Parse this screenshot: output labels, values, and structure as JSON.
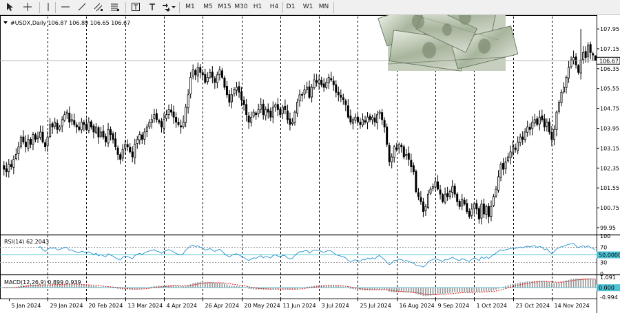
{
  "toolbar": {
    "timeframes": [
      "M1",
      "M5",
      "M15",
      "M30",
      "H1",
      "H4",
      "D1",
      "W1",
      "MN"
    ]
  },
  "colors": {
    "candle": "#000000",
    "rsi_line": "#1f8fd0",
    "rsi_level": "#4fc3d6",
    "macd_signal": "#d01818",
    "macd_hist": "#9a9a9a",
    "macd_zero": "#4fc3d6",
    "grid": "#000000",
    "price_line": "#b0b0b0"
  },
  "chart_data": [
    {
      "type": "candlestick",
      "title": "#USDX,Daily 106.87 106.89 106.65 106.67",
      "symbol": "#USDX",
      "timeframe": "Daily",
      "ohlc_last": {
        "open": 106.87,
        "high": 106.89,
        "low": 106.65,
        "close": 106.67
      },
      "current_price_label": "106.67",
      "ylim": [
        99.7,
        108.45
      ],
      "y_ticks": [
        "107.95",
        "107.15",
        "106.35",
        "105.55",
        "104.75",
        "103.95",
        "103.15",
        "102.35",
        "101.55",
        "100.75",
        "99.95"
      ],
      "x_ticks": [
        "5 Jan 2024",
        "29 Jan 2024",
        "20 Feb 2024",
        "13 Mar 2024",
        "4 Apr 2024",
        "26 Apr 2024",
        "20 May 2024",
        "11 Jun 2024",
        "3 Jul 2024",
        "25 Jul 2024",
        "16 Aug 2024",
        "9 Sep 2024",
        "1 Oct 2024",
        "23 Oct 2024",
        "14 Nov 2024"
      ],
      "closes": [
        102.3,
        102.2,
        102.5,
        102.4,
        102.7,
        102.9,
        103.2,
        103.6,
        103.4,
        103.2,
        103.5,
        103.3,
        103.7,
        103.5,
        103.6,
        103.8,
        103.4,
        103.2,
        103.6,
        104.1,
        104.0,
        104.2,
        103.9,
        104.0,
        104.3,
        104.5,
        104.6,
        104.2,
        104.3,
        104.1,
        104.0,
        103.9,
        104.2,
        104.1,
        103.9,
        104.2,
        104.0,
        103.8,
        104.0,
        103.6,
        103.8,
        103.6,
        103.4,
        103.9,
        103.7,
        103.5,
        103.2,
        102.9,
        102.7,
        103.1,
        103.3,
        103.2,
        103.0,
        102.8,
        103.3,
        103.5,
        103.7,
        103.5,
        103.8,
        104.0,
        104.2,
        104.3,
        104.5,
        104.3,
        104.2,
        104.0,
        104.3,
        104.5,
        104.7,
        104.6,
        104.4,
        104.2,
        104.1,
        104.0,
        104.2,
        104.8,
        105.3,
        106.0,
        106.3,
        106.1,
        106.4,
        106.2,
        106.1,
        105.8,
        106.0,
        106.2,
        106.0,
        105.8,
        106.1,
        106.3,
        106.0,
        105.6,
        105.3,
        105.0,
        105.3,
        105.5,
        105.6,
        105.4,
        105.1,
        104.9,
        104.5,
        104.2,
        104.4,
        104.6,
        104.5,
        104.7,
        104.9,
        104.5,
        104.7,
        104.6,
        104.4,
        104.8,
        104.9,
        104.7,
        104.5,
        104.8,
        104.7,
        104.3,
        104.1,
        104.2,
        104.6,
        105.0,
        105.3,
        105.3,
        105.5,
        105.6,
        105.2,
        105.6,
        105.9,
        105.8,
        105.9,
        105.7,
        105.6,
        105.8,
        106.0,
        105.9,
        105.7,
        105.4,
        105.3,
        105.2,
        105.1,
        104.9,
        104.4,
        104.2,
        104.3,
        104.4,
        104.2,
        104.1,
        104.3,
        104.2,
        104.4,
        104.3,
        104.4,
        104.2,
        104.5,
        104.6,
        104.3,
        104.0,
        103.3,
        102.6,
        102.8,
        103.2,
        103.1,
        103.3,
        103.2,
        102.8,
        102.9,
        102.7,
        102.4,
        102.2,
        101.4,
        101.2,
        101.0,
        100.6,
        100.8,
        101.3,
        101.5,
        101.6,
        101.8,
        101.5,
        101.3,
        101.0,
        101.3,
        101.2,
        101.4,
        101.6,
        101.3,
        101.0,
        100.8,
        101.1,
        100.9,
        100.6,
        100.4,
        100.7,
        100.9,
        100.7,
        100.3,
        100.9,
        100.5,
        100.8,
        100.4,
        100.8,
        101.2,
        101.5,
        102.0,
        102.5,
        102.3,
        102.6,
        102.8,
        103.0,
        103.2,
        103.1,
        103.4,
        103.6,
        103.5,
        103.8,
        104.0,
        103.9,
        104.2,
        104.3,
        104.1,
        104.4,
        104.3,
        104.0,
        104.2,
        103.8,
        103.5,
        103.9,
        104.6,
        105.0,
        105.4,
        105.6,
        106.0,
        106.4,
        106.7,
        106.8,
        106.5,
        106.2,
        106.7,
        107.0,
        106.8,
        107.3,
        107.0,
        106.9,
        106.67
      ],
      "rsi": {
        "label": "RSI(14) 62.2043",
        "period": 14,
        "value": 62.2043,
        "level_label": "50.0000",
        "ylim": [
          0,
          100
        ],
        "y_ticks": [
          "100",
          "70",
          "30",
          "0"
        ]
      },
      "macd": {
        "label": "MACD(12,26,9) 0.899 0.939",
        "params": [
          12,
          26,
          9
        ],
        "macd": 0.899,
        "signal": 0.939,
        "y_ticks": [
          "1.091",
          "0.000",
          "-0.994"
        ]
      }
    }
  ]
}
